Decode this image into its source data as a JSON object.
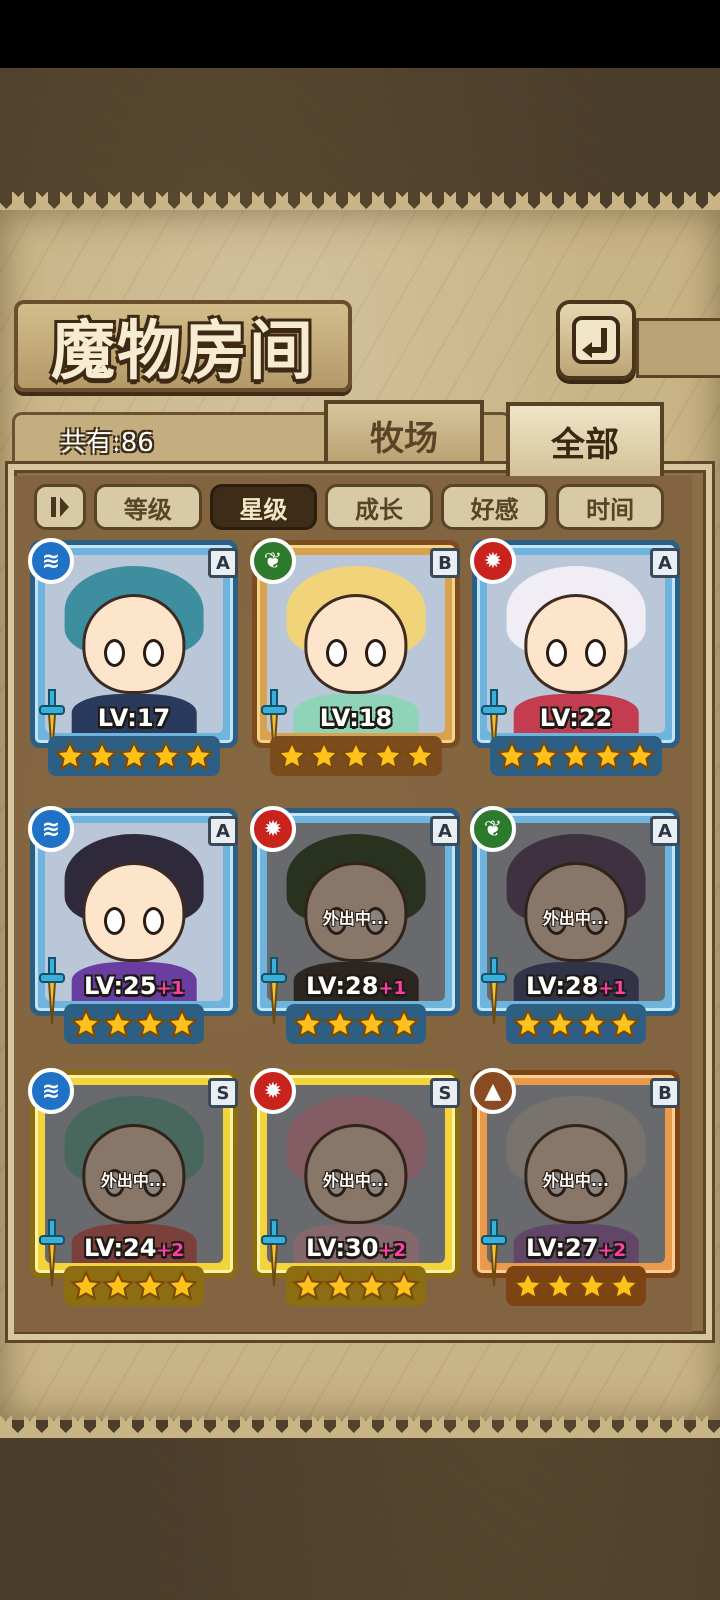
{
  "screen": {
    "title": "魔物房间",
    "count_label": "共有:86",
    "tabs": [
      {
        "label": "牧场",
        "active": false
      },
      {
        "label": "全部",
        "active": true
      }
    ],
    "filters": {
      "sort_toggle_icon": "sort-order-icon",
      "items": [
        {
          "label": "等级",
          "active": false
        },
        {
          "label": "星级",
          "active": true
        },
        {
          "label": "成长",
          "active": false
        },
        {
          "label": "好感",
          "active": false
        },
        {
          "label": "时间",
          "active": false
        }
      ]
    },
    "back_icon": "back-arrow-icon",
    "away_label": "外出中..."
  },
  "monsters": [
    {
      "frame": "blue",
      "element": "water",
      "element_icon": "water-icon",
      "rank": "A",
      "level": "LV:17",
      "plus": "",
      "stars": 5,
      "away": false
    },
    {
      "frame": "gold",
      "element": "leaf",
      "element_icon": "leaf-icon",
      "rank": "B",
      "level": "LV:18",
      "plus": "",
      "stars": 5,
      "away": false
    },
    {
      "frame": "blue",
      "element": "fire",
      "element_icon": "fire-icon",
      "rank": "A",
      "level": "LV:22",
      "plus": "",
      "stars": 5,
      "away": false
    },
    {
      "frame": "blue",
      "element": "water",
      "element_icon": "water-icon",
      "rank": "A",
      "level": "LV:25",
      "plus": "+1",
      "stars": 4,
      "away": false
    },
    {
      "frame": "blue",
      "element": "fire",
      "element_icon": "fire-icon",
      "rank": "A",
      "level": "LV:28",
      "plus": "+1",
      "stars": 4,
      "away": true
    },
    {
      "frame": "blue",
      "element": "leaf",
      "element_icon": "leaf-icon",
      "rank": "A",
      "level": "LV:28",
      "plus": "+1",
      "stars": 4,
      "away": true
    },
    {
      "frame": "yellow",
      "element": "water",
      "element_icon": "water-icon",
      "rank": "S",
      "level": "LV:24",
      "plus": "+2",
      "stars": 4,
      "away": true
    },
    {
      "frame": "yellow",
      "element": "fire",
      "element_icon": "fire-icon",
      "rank": "S",
      "level": "LV:30",
      "plus": "+2",
      "stars": 4,
      "away": true
    },
    {
      "frame": "orange",
      "element": "earth",
      "element_icon": "earth-icon",
      "rank": "B",
      "level": "LV:27",
      "plus": "+2",
      "stars": 4,
      "away": true
    }
  ],
  "colors": {
    "water": "#1f72c6",
    "fire": "#c8231d",
    "leaf": "#2e7a2c",
    "earth": "#8b4b22",
    "level_plus": "#ff3fa7",
    "star": "#ffc21a"
  }
}
